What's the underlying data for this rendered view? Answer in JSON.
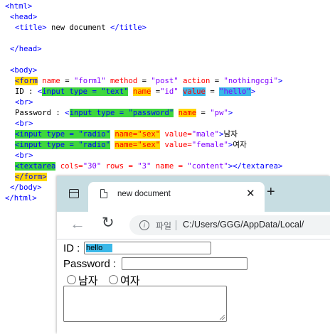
{
  "editor": {
    "l01": "<html>",
    "l02": "<head>",
    "l03_open": "<title>",
    "l03_text": " new document ",
    "l03_close": "</title>",
    "l04": "</head>",
    "l05": "<body>",
    "l06": {
      "lt": "<",
      "tag": "form",
      "a1": " name ",
      "eq1": "= ",
      "v1": "\"form1\"",
      "a2": " method ",
      "eq2": "= ",
      "v2": "\"post\"",
      "a3": " action ",
      "eq3": "= ",
      "v3": "\"nothingcgi\"",
      "gt": ">"
    },
    "l07": {
      "text": "ID : ",
      "lt": "<",
      "tag": "input type = \"text\"",
      "sp1": " ",
      "a1": "name",
      "eq1": " =",
      "v1": "\"id\"",
      "sp2": " ",
      "a2": "value",
      "eq2": " = ",
      "v2": "\"hello\"",
      "gt": ">"
    },
    "l08": "<br>",
    "l09": {
      "text": "Password : ",
      "lt": "<",
      "tag": "input type = \"password\"",
      "sp1": " ",
      "a1": "name",
      "eq1": " = ",
      "v1": "\"pw\"",
      "gt": ">"
    },
    "l10": "<br>",
    "l11": {
      "lt": "<",
      "tag": "input type = \"radio\"",
      "sp1": " ",
      "a1": "name=\"sex\"",
      "sp2": " ",
      "a2": "value=",
      "v2": "\"male\"",
      "gt": ">",
      "text": "남자"
    },
    "l12": {
      "lt": "<",
      "tag": "input type = \"radio\"",
      "sp1": " ",
      "a1": "name=\"sex\"",
      "sp2": " ",
      "a2": "value=",
      "v2": "\"female\"",
      "gt": ">",
      "text": "여자"
    },
    "l13": "<br>",
    "l14": {
      "lt": "<",
      "tag": "textarea",
      "a1": " cols=",
      "v1": "\"30\"",
      "a2": " rows = ",
      "v2": "\"3\"",
      "a3": " name = ",
      "v3": "\"content\"",
      "close": "></textarea>"
    },
    "l15": {
      "lt": "<",
      "tag": "/form",
      "gt": ">"
    },
    "l16": "</body>",
    "l17": "</html>"
  },
  "browser": {
    "tab_title": "new document",
    "tab_close": "✕",
    "new_tab": "+",
    "back": "←",
    "reload": "↻",
    "info": "i",
    "scheme_label": "파일",
    "url": "C:/Users/GGG/AppData/Local/"
  },
  "page": {
    "id_label": "ID : ",
    "id_value": "hello",
    "password_label": "Password : ",
    "radio_male": "남자",
    "radio_female": "여자"
  }
}
